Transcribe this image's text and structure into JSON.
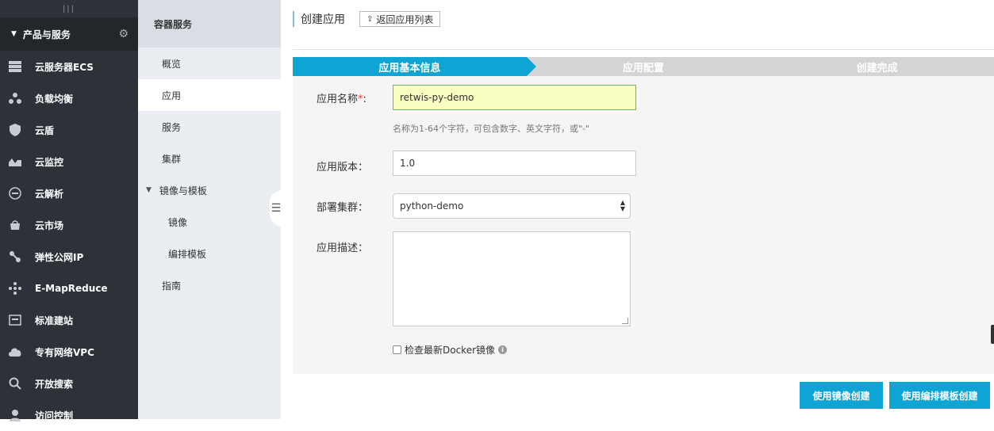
{
  "sidebar": {
    "products_label": "产品与服务",
    "items": [
      {
        "label": "云服务器ECS",
        "icon": "server-icon"
      },
      {
        "label": "负载均衡",
        "icon": "load-balancer-icon"
      },
      {
        "label": "云盾",
        "icon": "shield-icon"
      },
      {
        "label": "云监控",
        "icon": "monitor-icon"
      },
      {
        "label": "云解析",
        "icon": "dns-icon"
      },
      {
        "label": "云市场",
        "icon": "market-icon"
      },
      {
        "label": "弹性公网IP",
        "icon": "elastic-ip-icon"
      },
      {
        "label": "E-MapReduce",
        "icon": "mapreduce-icon"
      },
      {
        "label": "标准建站",
        "icon": "website-icon"
      },
      {
        "label": "专有网络VPC",
        "icon": "vpc-cloud-icon"
      },
      {
        "label": "开放搜索",
        "icon": "search-icon"
      },
      {
        "label": "访问控制",
        "icon": "access-control-icon"
      }
    ]
  },
  "submenu": {
    "title": "容器服务",
    "items": {
      "overview": "概览",
      "apps": "应用",
      "services": "服务",
      "clusters": "集群",
      "images_templates": "镜像与模板",
      "images": "镜像",
      "compose_templates": "编排模板",
      "guide": "指南"
    }
  },
  "header": {
    "title": "创建应用",
    "back_label": "返回应用列表"
  },
  "steps": [
    "应用基本信息",
    "应用配置",
    "创建完成"
  ],
  "form": {
    "name_label": "应用名称",
    "name_required": "*",
    "name_colon": ":",
    "name_value": "retwis-py-demo",
    "name_hint": "名称为1-64个字符，可包含数字、英文字符，或\"-\"",
    "version_label": "应用版本：",
    "version_value": "1.0",
    "cluster_label": "部署集群：",
    "cluster_value": "python-demo",
    "desc_label": "应用描述：",
    "check_label": "检查最新Docker镜像"
  },
  "buttons": {
    "create_from_image": "使用镜像创建",
    "create_from_template": "使用编排模板创建"
  },
  "colors": {
    "sidebar_bg": "#2c3238",
    "submenu_bg": "#eaedf1",
    "accent": "#0ea5d4",
    "step_inactive": "#d4d4d4",
    "name_field_bg": "#fafdc0"
  }
}
